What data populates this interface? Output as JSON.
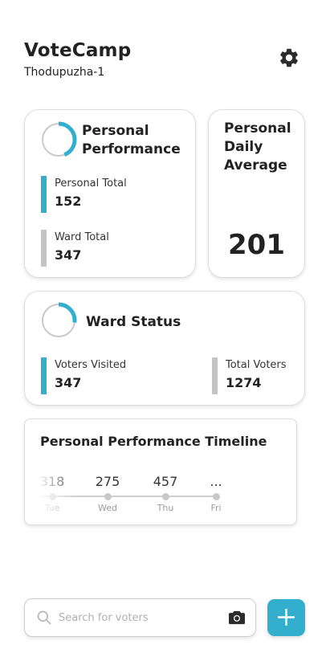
{
  "header": {
    "title": "VoteCamp",
    "subtitle": "Thodupuzha-1"
  },
  "personal_performance": {
    "title_line1": "Personal",
    "title_line2": "Performance",
    "personal_total_label": "Personal Total",
    "personal_total_value": "152",
    "ward_total_label": "Ward Total",
    "ward_total_value": "347",
    "ring_progress": 0.44
  },
  "daily_average": {
    "title_line1": "Personal",
    "title_line2": "Daily",
    "title_line3": "Average",
    "value": "201"
  },
  "ward_status": {
    "title": "Ward Status",
    "visited_label": "Voters Visited",
    "visited_value": "347",
    "total_label": "Total Voters",
    "total_value": "1274",
    "ring_progress": 0.27
  },
  "timeline": {
    "title": "Personal Performance Timeline",
    "points": [
      {
        "value": "318",
        "day": "Tue"
      },
      {
        "value": "275",
        "day": "Wed"
      },
      {
        "value": "457",
        "day": "Thu"
      },
      {
        "value": "...",
        "day": "Fri"
      }
    ]
  },
  "search": {
    "placeholder": "Search for voters"
  },
  "colors": {
    "accent": "#34aecd",
    "gray_bar": "#c4c4c4"
  }
}
